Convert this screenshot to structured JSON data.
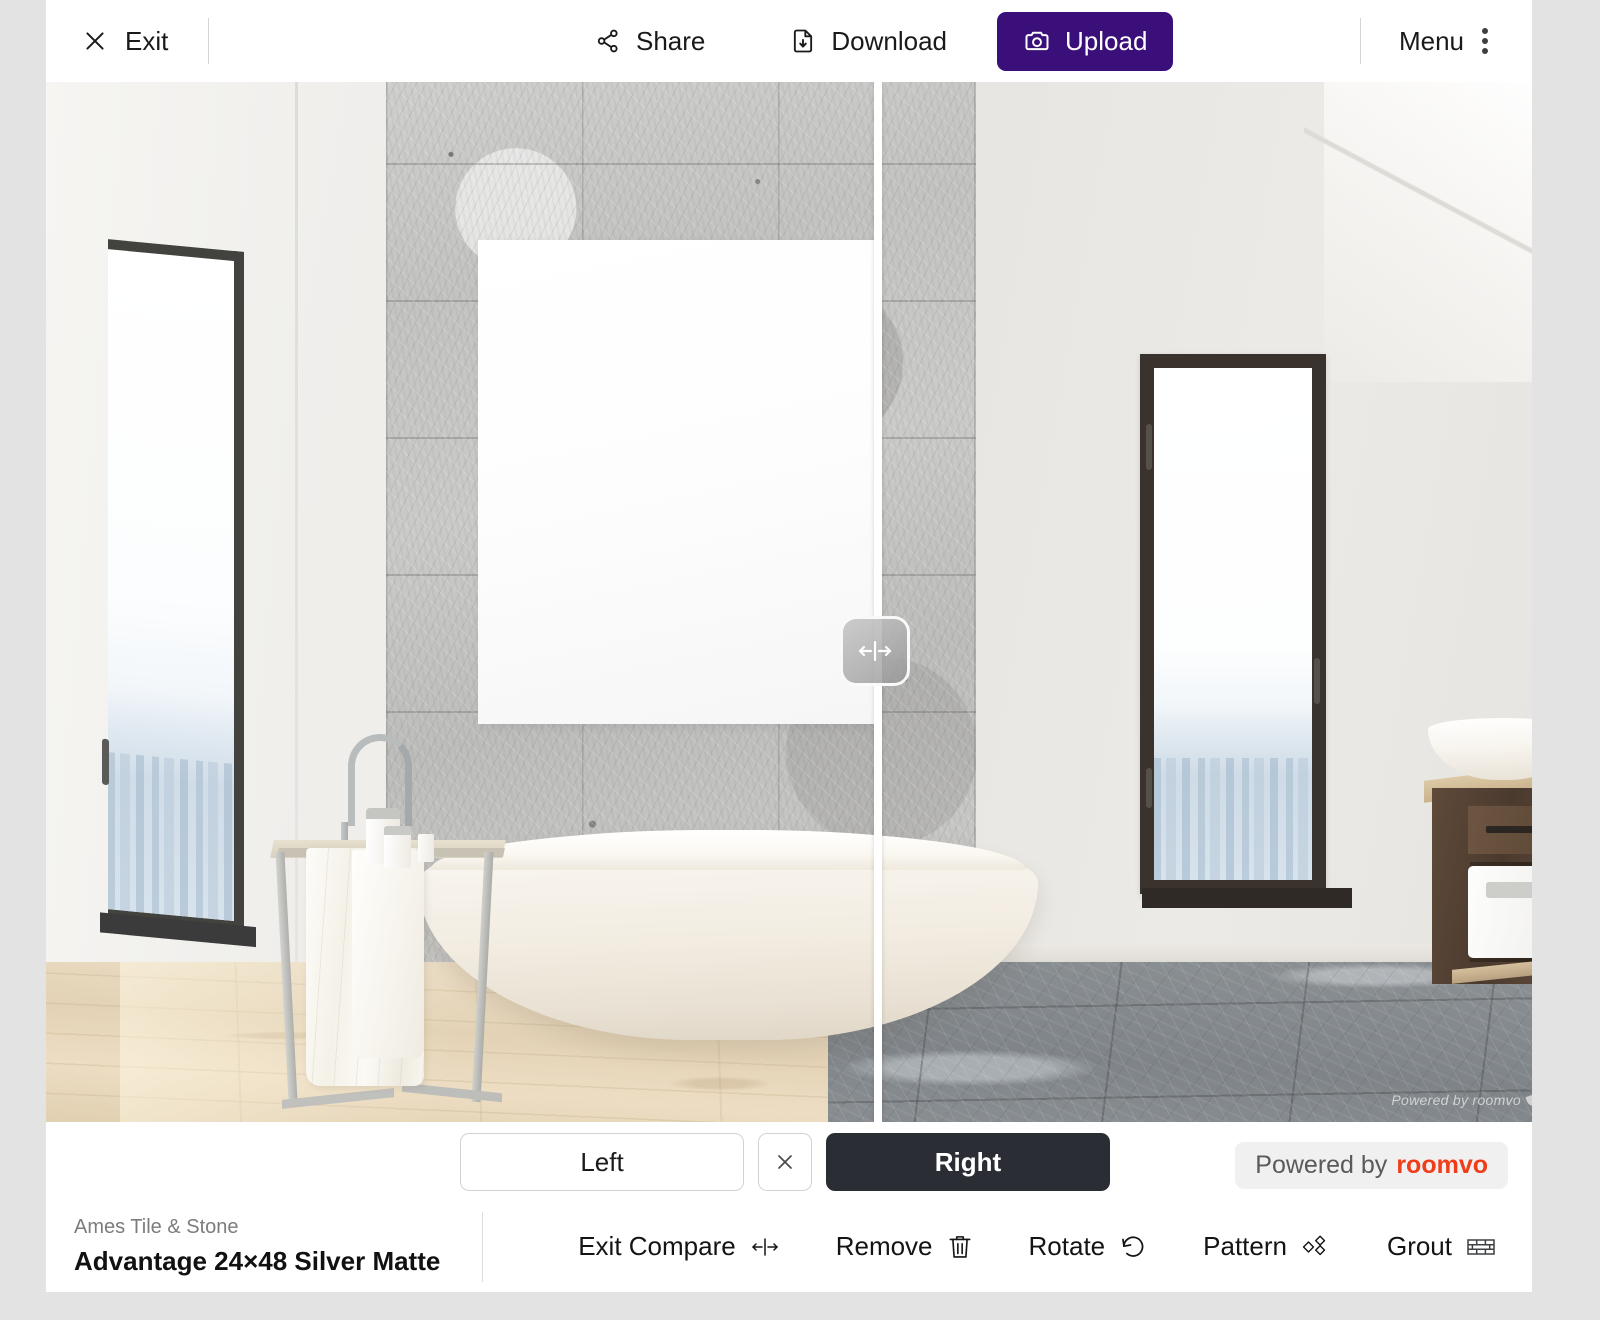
{
  "topbar": {
    "exit_label": "Exit",
    "exit_icon": "close-x-icon",
    "share_label": "Share",
    "share_icon": "share-nodes-icon",
    "download_label": "Download",
    "download_icon": "file-download-icon",
    "upload_label": "Upload",
    "upload_icon": "camera-icon",
    "upload_bg": "#3B0F7A",
    "menu_label": "Menu",
    "menu_icon": "three-dots-vertical-icon"
  },
  "viewer": {
    "divider_handle_icon": "left-right-arrows-icon",
    "watermark": "Powered by roomvo",
    "scene_description": "Bathroom with freestanding tub, stone feature wall, tall windows; left half original light wood floor, right half grey stone tile"
  },
  "compare": {
    "left_label": "Left",
    "close_icon": "close-x-icon",
    "right_label": "Right",
    "active_side": "Right",
    "powered_prefix": "Powered by",
    "powered_brand": "roomvo",
    "brand_color": "#F03C18"
  },
  "product": {
    "brand": "Ames Tile & Stone",
    "name": "Advantage 24×48 Silver Matte"
  },
  "actions": [
    {
      "label": "Exit Compare",
      "icon": "compare-arrows-icon"
    },
    {
      "label": "Remove",
      "icon": "trash-icon"
    },
    {
      "label": "Rotate",
      "icon": "rotate-ccw-icon"
    },
    {
      "label": "Pattern",
      "icon": "diamond-pattern-icon"
    },
    {
      "label": "Grout",
      "icon": "brick-grid-icon"
    }
  ]
}
